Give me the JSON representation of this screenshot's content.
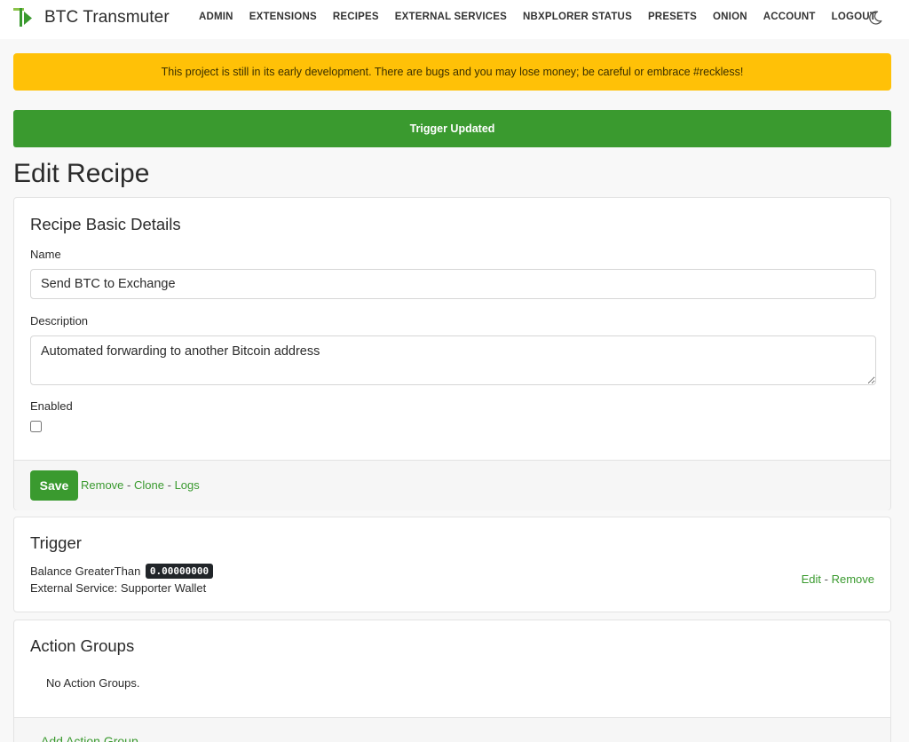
{
  "app": {
    "name": "BTC Transmuter",
    "logo_icon": "transmuter-logo-icon",
    "theme_toggle_icon": "moon-icon"
  },
  "nav": {
    "items": [
      "ADMIN",
      "EXTENSIONS",
      "RECIPES",
      "EXTERNAL SERVICES",
      "NBXPLORER STATUS",
      "PRESETS",
      "ONION",
      "ACCOUNT",
      "LOGOUT"
    ]
  },
  "alerts": {
    "warning": "This project is still in its early development. There are bugs and you may lose money; be careful or embrace #reckless!",
    "success": "Trigger Updated"
  },
  "page": {
    "title": "Edit Recipe"
  },
  "basic": {
    "title": "Recipe Basic Details",
    "name_label": "Name",
    "name_value": "Send BTC to Exchange",
    "description_label": "Description",
    "description_value": "Automated forwarding to another Bitcoin address",
    "enabled_label": "Enabled",
    "enabled": false,
    "save_label": "Save",
    "remove_label": "Remove",
    "clone_label": "Clone",
    "logs_label": "Logs",
    "separator": "-"
  },
  "trigger": {
    "title": "Trigger",
    "condition_text": "Balance GreaterThan",
    "amount": "0.00000000",
    "service_text": "External Service: Supporter Wallet",
    "edit_label": "Edit",
    "remove_label": "Remove",
    "separator": "-"
  },
  "action_groups": {
    "title": "Action Groups",
    "empty_text": "No Action Groups.",
    "add_label": "Add Action Group"
  },
  "colors": {
    "accent": "#3a9a2f",
    "warning": "#ffc107",
    "badge": "#212529"
  }
}
